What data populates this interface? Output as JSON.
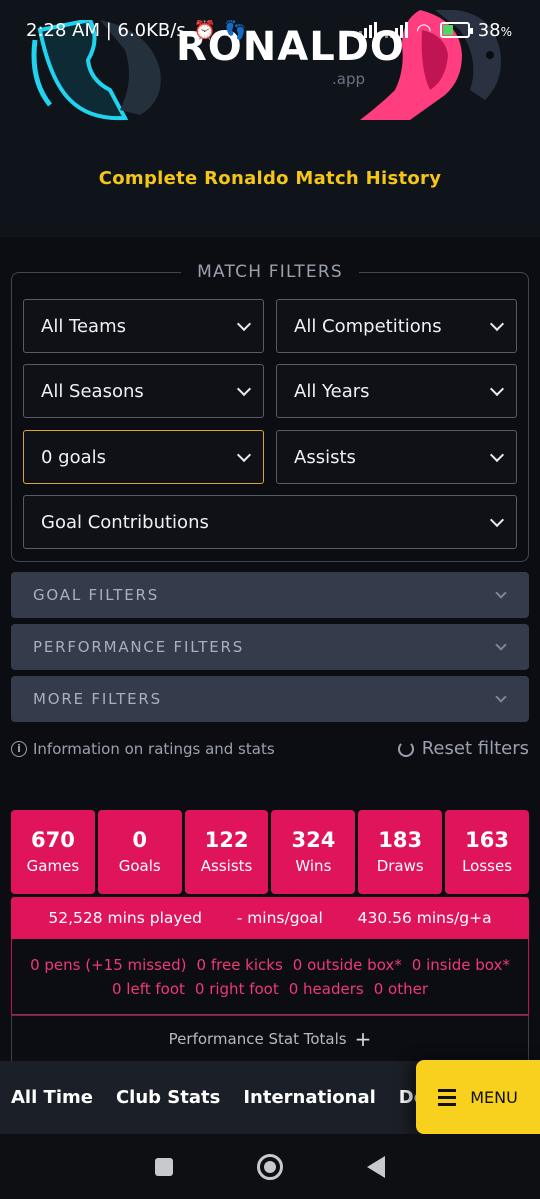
{
  "status_bar": {
    "time_speed": "2:28 AM | 6.0KB/s",
    "battery": "38",
    "battery_unit": "%"
  },
  "hero": {
    "logo": "RONALDO",
    "logo_sub": ".app",
    "tagline": "Complete Ronaldo Match History"
  },
  "match_filters": {
    "legend": "MATCH FILTERS",
    "selects": {
      "teams": "All Teams",
      "competitions": "All Competitions",
      "seasons": "All Seasons",
      "years": "All Years",
      "goals": "0 goals",
      "assists": "Assists",
      "goal_contributions": "Goal Contributions"
    }
  },
  "accordions": {
    "goal": "GOAL FILTERS",
    "performance": "PERFORMANCE FILTERS",
    "more": "MORE FILTERS"
  },
  "info_link": "Information on ratings and stats",
  "reset_link": "Reset filters",
  "stats": [
    {
      "value": "670",
      "label": "Games"
    },
    {
      "value": "0",
      "label": "Goals"
    },
    {
      "value": "122",
      "label": "Assists"
    },
    {
      "value": "324",
      "label": "Wins"
    },
    {
      "value": "183",
      "label": "Draws"
    },
    {
      "value": "163",
      "label": "Losses"
    }
  ],
  "minutes": {
    "played": "52,528 mins played",
    "per_goal": "- mins/goal",
    "per_ga": "430.56 mins/g+a"
  },
  "details": {
    "pens": "0 pens (+15 missed)",
    "free_kicks": "0 free kicks",
    "outside_box": "0 outside box*",
    "inside_box": "0 inside box*",
    "left_foot": "0 left foot",
    "right_foot": "0 right foot",
    "headers": "0 headers",
    "other": "0 other"
  },
  "perf_totals": "Performance Stat Totals",
  "bottom_nav": {
    "items": [
      "All Time",
      "Club Stats",
      "International",
      "Detailed"
    ],
    "menu": "MENU"
  },
  "colors": {
    "accent_pink": "#e0145a",
    "accent_yellow": "#f5c518",
    "background": "#0b0d12"
  }
}
